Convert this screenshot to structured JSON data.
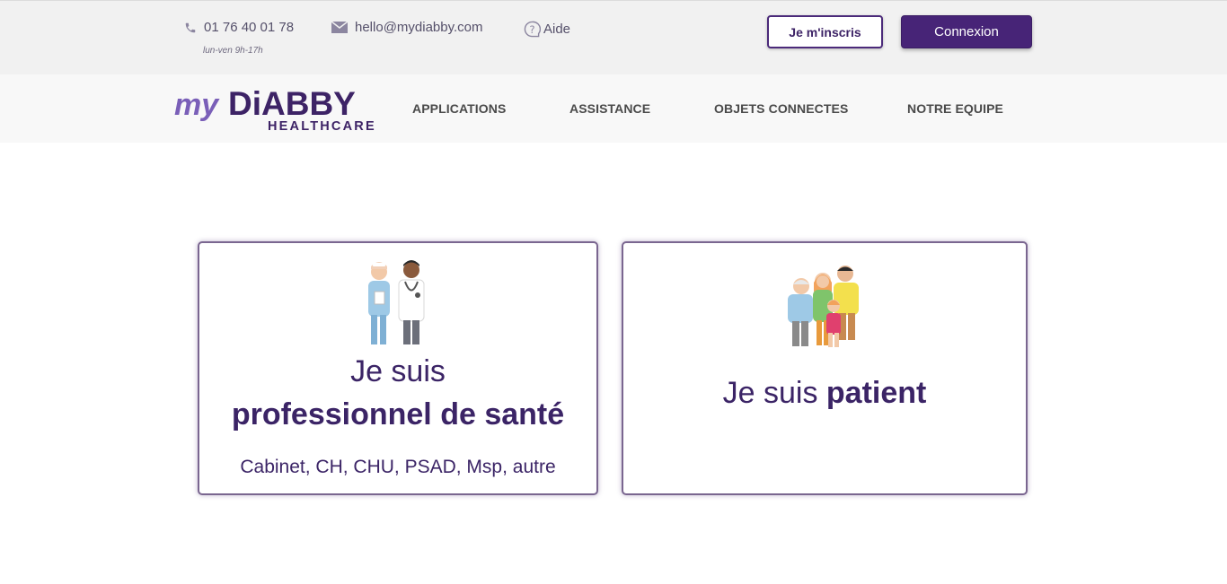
{
  "topbar": {
    "phone": "01 76 40 01 78",
    "hours": "lun-ven 9h-17h",
    "email": "hello@mydiabby.com",
    "help": "Aide",
    "signup_label": "Je m'inscris",
    "login_label": "Connexion"
  },
  "brand": {
    "logo_my": "my",
    "logo_diabby": "DiABBY",
    "logo_healthcare": "HEALTHCARE"
  },
  "nav": {
    "items": [
      "APPLICATIONS",
      "ASSISTANCE",
      "OBJETS CONNECTES",
      "NOTRE EQUIPE"
    ]
  },
  "cards": {
    "pro": {
      "line1": "Je suis",
      "line2": "professionnel de santé",
      "subtitle": "Cabinet, CH, CHU, PSAD, Msp, autre"
    },
    "patient": {
      "prefix": "Je suis",
      "emphasis": "patient"
    }
  },
  "icons": {
    "phone": "phone-icon",
    "email": "mail-icon",
    "help": "help-bubble-icon",
    "pro": "doctors-illustration",
    "patient": "family-illustration"
  },
  "colors": {
    "brand_purple": "#472477",
    "logo_light_purple": "#7a5fb8",
    "text_purple": "#3b2466"
  }
}
